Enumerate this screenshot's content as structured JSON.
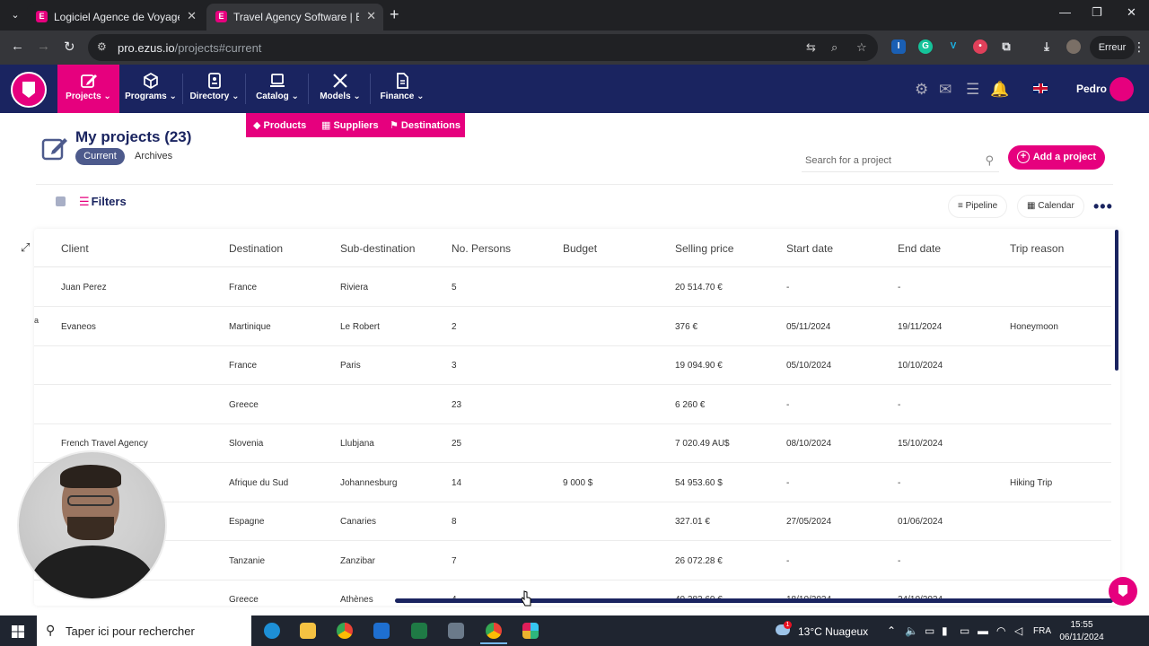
{
  "browser": {
    "tabs": [
      {
        "title": "Logiciel Agence de Voyage | Ezus",
        "active": false
      },
      {
        "title": "Travel Agency Software | Ezus",
        "active": true
      }
    ],
    "url_host": "pro.ezus.io",
    "url_path": "/projects#current",
    "profile_label": "Erreur"
  },
  "nav": {
    "items": [
      {
        "label": "Projects",
        "icon": "edit-icon",
        "active": true
      },
      {
        "label": "Programs",
        "icon": "cube-icon",
        "active": false
      },
      {
        "label": "Directory",
        "icon": "contacts-icon",
        "active": false
      },
      {
        "label": "Catalog",
        "icon": "laptop-icon",
        "active": false
      },
      {
        "label": "Models",
        "icon": "tools-icon",
        "active": false
      },
      {
        "label": "Finance",
        "icon": "document-icon",
        "active": false
      }
    ],
    "user_name": "Pedro",
    "submenu": [
      "Products",
      "Suppliers",
      "Destinations"
    ]
  },
  "page": {
    "title": "My projects (23)",
    "tab_current": "Current",
    "tab_archives": "Archives",
    "search_placeholder": "Search for a project",
    "add_button": "Add a project",
    "filters_label": "Filters",
    "pipeline_label": "Pipeline",
    "calendar_label": "Calendar",
    "edge_char": "a"
  },
  "table": {
    "columns": [
      "Client",
      "Destination",
      "Sub-destination",
      "No. Persons",
      "Budget",
      "Selling price",
      "Start date",
      "End date",
      "Trip reason"
    ],
    "rows": [
      [
        "Juan Perez",
        "France",
        "Riviera",
        "5",
        "",
        "20 514.70 €",
        "-",
        "-",
        ""
      ],
      [
        "Evaneos",
        "Martinique",
        "Le Robert",
        "2",
        "",
        "376 €",
        "05/11/2024",
        "19/11/2024",
        "Honeymoon"
      ],
      [
        "",
        "France",
        "Paris",
        "3",
        "",
        "19 094.90 €",
        "05/10/2024",
        "10/10/2024",
        ""
      ],
      [
        "",
        "Greece",
        "",
        "23",
        "",
        "6 260 €",
        "-",
        "-",
        ""
      ],
      [
        "French Travel Agency",
        "Slovenia",
        "Llubjana",
        "25",
        "",
        "7 020.49 AU$",
        "08/10/2024",
        "15/10/2024",
        ""
      ],
      [
        "",
        "Afrique du Sud",
        "Johannesburg",
        "14",
        "9 000 $",
        "54 953.60 $",
        "-",
        "-",
        "Hiking Trip"
      ],
      [
        "",
        "Espagne",
        "Canaries",
        "8",
        "",
        "327.01 €",
        "27/05/2024",
        "01/06/2024",
        ""
      ],
      [
        "",
        "Tanzanie",
        "Zanzibar",
        "7",
        "",
        "26 072.28 €",
        "-",
        "-",
        ""
      ],
      [
        "",
        "Greece",
        "Athènes",
        "4",
        "",
        "40 283.60 €",
        "18/10/2024",
        "24/10/2024",
        ""
      ]
    ]
  },
  "taskbar": {
    "search_text": "Taper ici pour rechercher",
    "weather": "13°C  Nuageux",
    "weather_badge": "1",
    "lang": "FRA",
    "time": "15:55",
    "date": "06/11/2024"
  },
  "colors": {
    "brand_pink": "#e6007e",
    "navy": "#1a2460"
  }
}
